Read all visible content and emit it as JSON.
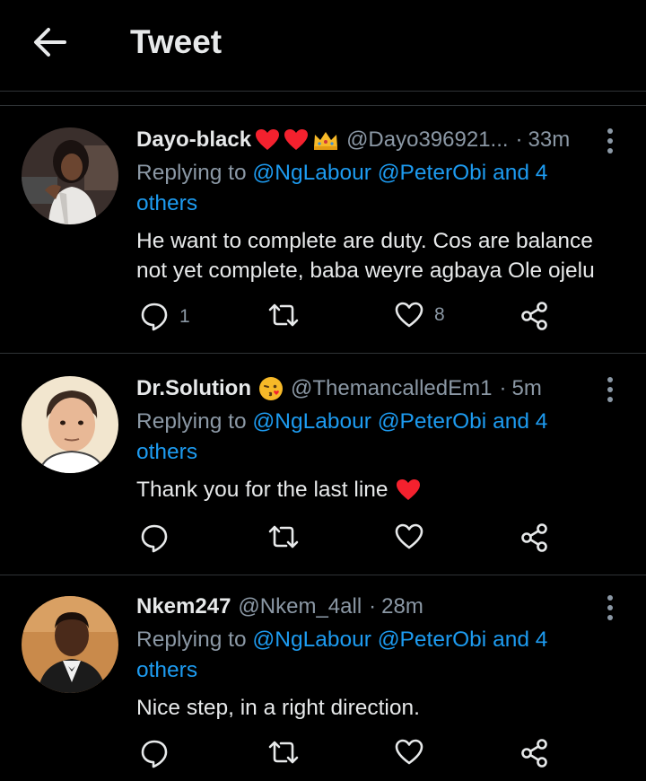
{
  "header": {
    "title": "Tweet"
  },
  "tweets": [
    {
      "name": "Dayo-black",
      "handle": "@Dayo396921...",
      "dot": "·",
      "time": "33m",
      "reply_prefix": "Replying to",
      "mention1": "@NgLabour",
      "mention2": "@PeterObi",
      "and_others_1": "and 4",
      "and_others_2": "others",
      "text_line1": "He want to complete are duty. Cos are balance",
      "text_line2": "not yet complete, baba weyre agbaya Ole ojelu",
      "reply_count": "1",
      "retweet_count": "",
      "like_count": "8"
    },
    {
      "name": "Dr.Solution",
      "handle": "@ThemancalledEm1",
      "dot": "·",
      "time": "5m",
      "reply_prefix": "Replying to",
      "mention1": "@NgLabour",
      "mention2": "@PeterObi",
      "and_others_1": "and 4",
      "and_others_2": "others",
      "text_line1": "Thank you for the last line",
      "reply_count": "",
      "retweet_count": "",
      "like_count": ""
    },
    {
      "name": "Nkem247",
      "handle": "@Nkem_4all",
      "dot": "·",
      "time": "28m",
      "reply_prefix": "Replying to",
      "mention1": "@NgLabour",
      "mention2": "@PeterObi",
      "and_others_1": "and 4",
      "and_others_2": "others",
      "text_line1": "Nice step, in a right direction.",
      "reply_count": "",
      "retweet_count": "",
      "like_count": ""
    }
  ],
  "colors": {
    "accent": "#1d9bf0",
    "muted": "#8b98a5",
    "text": "#e7e9ea",
    "heart": "#f4212e"
  },
  "icons": [
    "back-arrow-icon",
    "more-icon",
    "reply-icon",
    "retweet-icon",
    "like-icon",
    "share-icon",
    "heart-emoji-icon",
    "crown-emoji-icon",
    "kissing-face-emoji-icon"
  ]
}
